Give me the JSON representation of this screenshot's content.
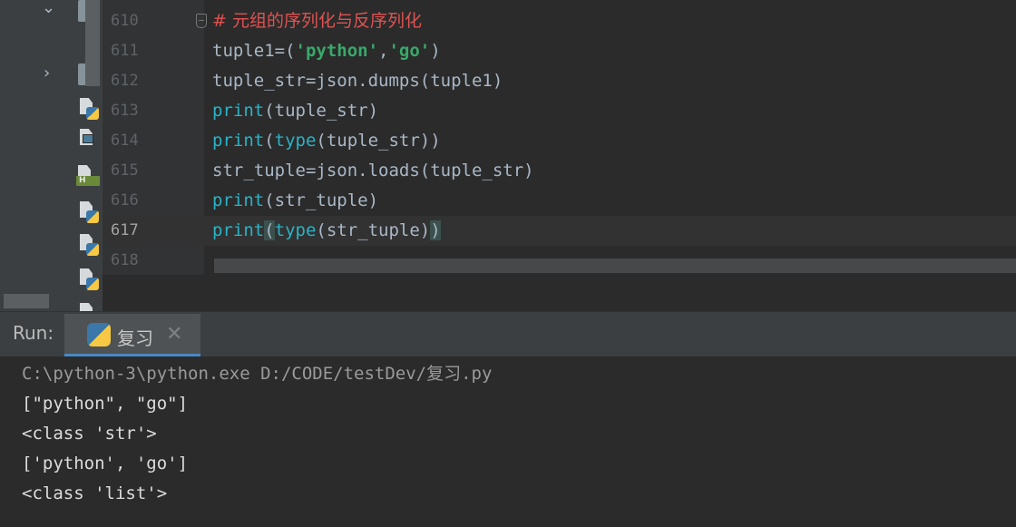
{
  "editor": {
    "lines": [
      {
        "num": "610",
        "segments": [
          {
            "t": "# 元组的序列化与反序列化",
            "c": "comment"
          }
        ]
      },
      {
        "num": "611",
        "segments": [
          {
            "t": "tuple1=(",
            "c": ""
          },
          {
            "t": "'python'",
            "c": "str"
          },
          {
            "t": ",",
            "c": ""
          },
          {
            "t": "'go'",
            "c": "str"
          },
          {
            "t": ")",
            "c": ""
          }
        ]
      },
      {
        "num": "612",
        "segments": [
          {
            "t": "tuple_str=json.dumps(tuple1)",
            "c": ""
          }
        ]
      },
      {
        "num": "613",
        "segments": [
          {
            "t": "print",
            "c": "kw"
          },
          {
            "t": "(tuple_str)",
            "c": ""
          }
        ]
      },
      {
        "num": "614",
        "segments": [
          {
            "t": "print",
            "c": "kw"
          },
          {
            "t": "(",
            "c": ""
          },
          {
            "t": "type",
            "c": "kw"
          },
          {
            "t": "(tuple_str))",
            "c": ""
          }
        ]
      },
      {
        "num": "615",
        "segments": [
          {
            "t": "str_tuple=json.loads(tuple_str)",
            "c": ""
          }
        ]
      },
      {
        "num": "616",
        "segments": [
          {
            "t": "print",
            "c": "kw"
          },
          {
            "t": "(str_tuple)",
            "c": ""
          }
        ]
      },
      {
        "num": "617",
        "segments": [
          {
            "t": "print",
            "c": "kw"
          },
          {
            "t": "(",
            "c": "brace-match"
          },
          {
            "t": "type",
            "c": "kw"
          },
          {
            "t": "(str_tuple)",
            "c": ""
          },
          {
            "t": ")",
            "c": "brace-match"
          }
        ]
      },
      {
        "num": "618",
        "segments": []
      }
    ],
    "current_line": "617"
  },
  "project_tree": {
    "file_badge_h": "H"
  },
  "run_panel": {
    "label": "Run:",
    "tab_label": "复习",
    "close_glyph": "✕",
    "output": [
      {
        "text": "C:\\python-3\\python.exe D:/CODE/testDev/复习.py",
        "kind": "cmd"
      },
      {
        "text": "[\"python\", \"go\"]",
        "kind": "out"
      },
      {
        "text": "<class 'str'>",
        "kind": "out"
      },
      {
        "text": "['python', 'go']",
        "kind": "out"
      },
      {
        "text": "<class 'list'>",
        "kind": "out"
      }
    ]
  },
  "icons": [
    "chevron-down-icon",
    "chevron-right-icon",
    "folder-icon",
    "python-file-icon",
    "image-file-icon",
    "html-file-icon",
    "fold-marker-icon",
    "python-run-icon",
    "close-icon"
  ],
  "colors": {
    "background": "#2b2b2b",
    "keyword": "#29b3c6",
    "string": "#39a86a",
    "comment": "#e05252",
    "text": "#a9b7c6",
    "tab_accent": "#4a88c7"
  }
}
